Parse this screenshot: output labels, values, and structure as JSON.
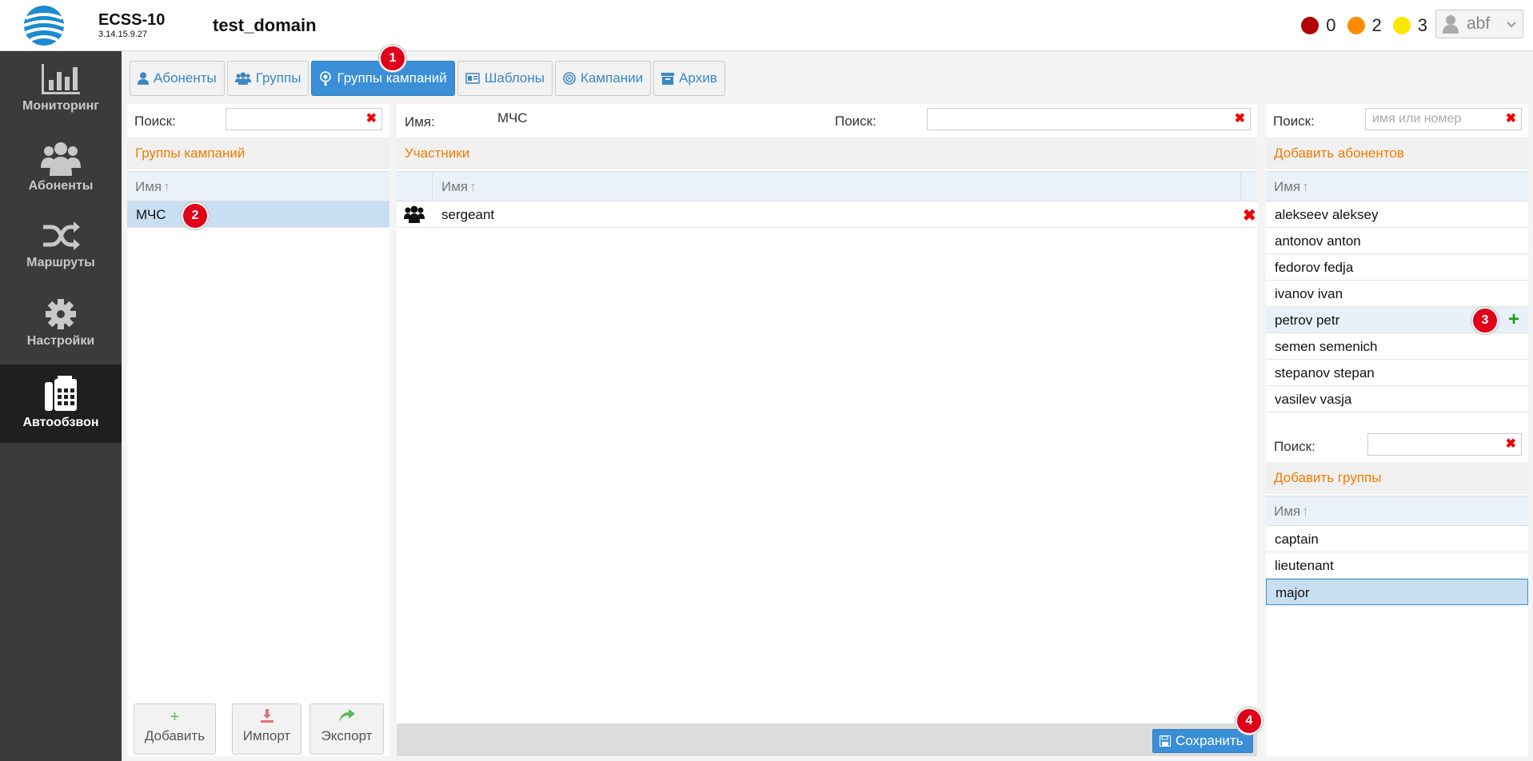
{
  "header": {
    "product": "ECSS-10",
    "version": "3.14.15.9.27",
    "domain": "test_domain",
    "alarms": [
      {
        "color": "#b30000",
        "count": "0"
      },
      {
        "color": "#ff8c00",
        "count": "2"
      },
      {
        "color": "#ffe600",
        "count": "3"
      }
    ],
    "user": "abf"
  },
  "sidebar": {
    "items": [
      {
        "label": "Мониторинг",
        "icon": "chart-icon"
      },
      {
        "label": "Абоненты",
        "icon": "users-icon"
      },
      {
        "label": "Маршруты",
        "icon": "shuffle-icon"
      },
      {
        "label": "Настройки",
        "icon": "gear-icon"
      },
      {
        "label": "Автообзвон",
        "icon": "fax-phone-icon"
      }
    ],
    "active_index": 4
  },
  "tabs": [
    {
      "label": "Абоненты",
      "icon": "user-icon"
    },
    {
      "label": "Группы",
      "icon": "users-icon"
    },
    {
      "label": "Группы кампаний",
      "icon": "broadcast-icon"
    },
    {
      "label": "Шаблоны",
      "icon": "template-icon"
    },
    {
      "label": "Кампании",
      "icon": "target-icon"
    },
    {
      "label": "Архив",
      "icon": "archive-icon"
    }
  ],
  "active_tab": 2,
  "badges": [
    "1",
    "2",
    "3",
    "4"
  ],
  "left_panel": {
    "search_label": "Поиск:",
    "search_value": "",
    "title": "Группы кампаний",
    "column": "Имя",
    "rows": [
      "МЧС"
    ],
    "buttons": {
      "add": "Добавить",
      "import": "Импорт",
      "export": "Экспорт"
    }
  },
  "middle_panel": {
    "name_label": "Имя:",
    "name_value": "МЧС",
    "search_label": "Поиск:",
    "search_value": "",
    "title": "Участники",
    "column": "Имя",
    "rows": [
      "sergeant"
    ],
    "save_label": "Сохранить"
  },
  "right_panel": {
    "search_label": "Поиск:",
    "search_placeholder": "имя или номер",
    "subscribers_title": "Добавить абонентов",
    "column": "Имя",
    "subscribers": [
      "alekseev aleksey",
      "antonov anton",
      "fedorov fedja",
      "ivanov ivan",
      "petrov petr",
      "semen semenich",
      "stepanov stepan",
      "vasilev vasja"
    ],
    "groups_search_label": "Поиск:",
    "groups_title": "Добавить группы",
    "groups_column": "Имя",
    "groups": [
      "captain",
      "lieutenant",
      "major"
    ]
  }
}
